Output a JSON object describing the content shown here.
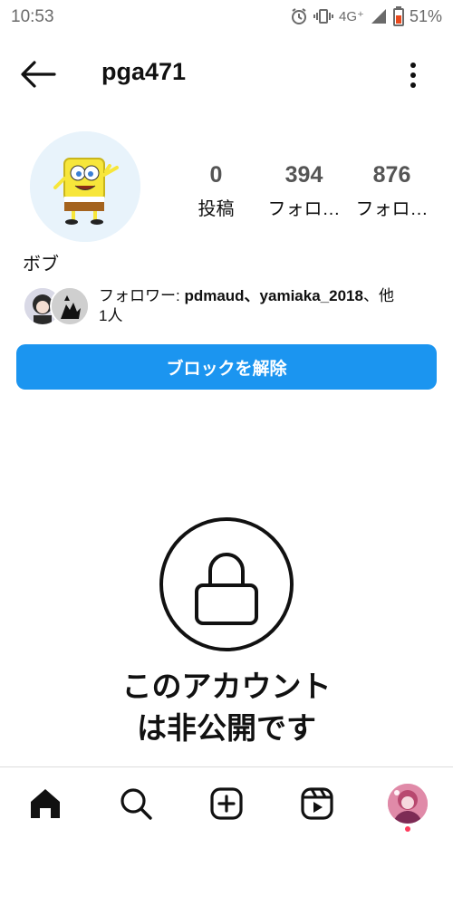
{
  "status_bar": {
    "time": "10:53",
    "network": "4G⁺",
    "battery": "51%"
  },
  "header": {
    "username": "pga471"
  },
  "profile": {
    "display_name": "ボブ",
    "stats": [
      {
        "value": "0",
        "label": "投稿"
      },
      {
        "value": "394",
        "label": "フォロ…"
      },
      {
        "value": "876",
        "label": "フォロ…"
      }
    ],
    "followed_by": {
      "prefix": "フォロワー: ",
      "names": "pdmaud、yamiaka_2018",
      "suffix": "、他",
      "line2": "1人"
    }
  },
  "actions": {
    "unblock_label": "ブロックを解除"
  },
  "private": {
    "line1": "このアカウント",
    "line2": "は非公開です"
  },
  "icons": {
    "back": "arrow-left-icon",
    "more": "more-vertical-icon",
    "lock": "lock-icon",
    "home": "home-icon",
    "search": "search-icon",
    "new_post": "plus-square-icon",
    "reels": "reels-icon"
  },
  "colors": {
    "accent": "#1b95f0",
    "notification_dot": "#ff3b5c"
  }
}
